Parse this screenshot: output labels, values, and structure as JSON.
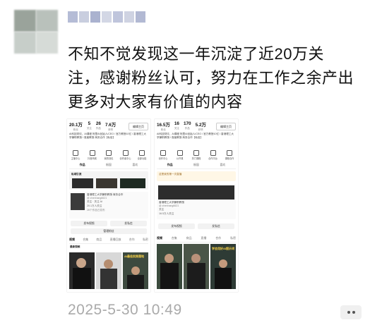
{
  "post": {
    "text": "不知不觉发现这一年沉淀了近20万关注，感谢粉丝认可，努力在工作之余产出更多对大家有价值的内容",
    "timestamp": "2025-5-30 10:49"
  },
  "screenshots": [
    {
      "stats": [
        {
          "value": "20.1万",
          "label": "粉丝"
        },
        {
          "value": "5",
          "label": "关注"
        },
        {
          "value": "26",
          "label": "作品"
        },
        {
          "value": "7.6万",
          "label": "获赞"
        }
      ],
      "edit_label": "编辑主页",
      "bio": "AI科技财评，AI课程 阿里AI创始人/CEO / 官方教授10亿 / 香港理工大学兼职教授 / 首届教授 商务合作【私信】",
      "icons": [
        "主播中心",
        "抖音商城",
        "我的钱包",
        "创作者中心",
        "全部功能"
      ],
      "tabs": [
        "作品",
        "橱窗",
        "喜欢"
      ],
      "card_title": "私域引流",
      "profile_text": "香港理工大学兼职教授 商务合作",
      "profile_handle": "@ zhenhang6621",
      "profile_meta": "关注 · 关注 AI",
      "profile_fans": "20.1万人关注",
      "profile_works": "26个作品已发布",
      "btn_left": "发布视频",
      "btn_right": "发私信",
      "btn_manage": "管理粉丝",
      "tabs2": [
        "视频",
        "合集",
        "商品",
        "直播回放",
        "合作",
        "私密"
      ],
      "latest_label": "最新视频",
      "video_caption": "AI最佳实践落地"
    },
    {
      "stats": [
        {
          "value": "16.5万",
          "label": "粉丝"
        },
        {
          "value": "16",
          "label": "关注"
        },
        {
          "value": "170",
          "label": "作品"
        },
        {
          "value": "5.2万",
          "label": "获赞"
        }
      ],
      "edit_label": "编辑主页",
      "bio": "AI科技财评，AI课程 阿里AI创始人/CEO / 官方教授10亿 / 香港理工大学兼职教授 / 首届教授 商务合作【私信】",
      "icons": [
        "创作中心",
        "公开课",
        "热门课程",
        "合作平台",
        "课程合作"
      ],
      "tabs": [
        "作品",
        "橱窗",
        "喜欢"
      ],
      "card_title": "这是我的第一次直播",
      "profile_text": "香港理工大学兼职教授",
      "profile_handle": "@ zhenhang6621",
      "profile_meta": "关注",
      "profile_fans": "16.5万人关注",
      "profile_works": "",
      "btn_left": "发布视频",
      "btn_right": "发私信",
      "btn_manage": "",
      "tabs2": [
        "视频",
        "合集",
        "商品",
        "直播",
        "合作",
        "私密"
      ],
      "latest_label": "",
      "video_caption": "学会用好AI提示词"
    }
  ]
}
